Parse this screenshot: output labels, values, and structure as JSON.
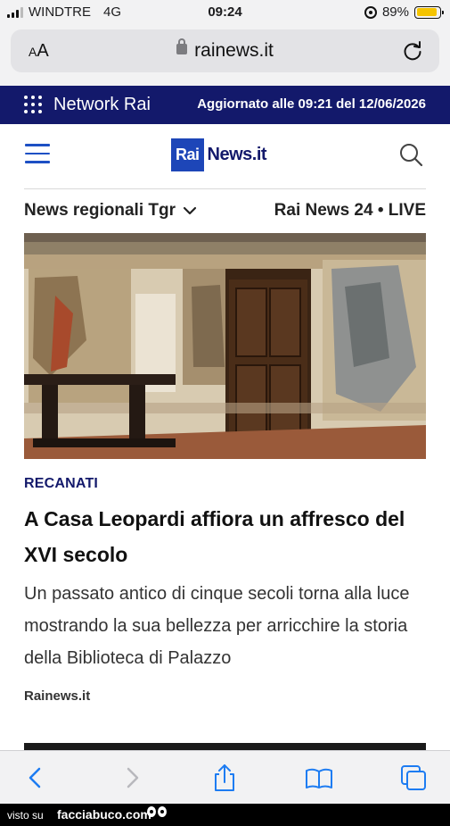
{
  "status_bar": {
    "carrier": "WINDTRE",
    "network": "4G",
    "time": "09:24",
    "battery": "89%",
    "battery_level": 0.89
  },
  "address_bar": {
    "aa_label": "AA",
    "domain": "rainews.it"
  },
  "network_bar": {
    "label": "Network Rai",
    "updated": "Aggiornato alle 09:21 del 12/06/2026"
  },
  "header": {
    "logo_rai": "Rai",
    "logo_news": "News.it",
    "regional_link": "News regionali Tgr",
    "live_link": "Rai News 24 • LIVE"
  },
  "article": {
    "kicker": "RECANATI",
    "title": "A Casa Leopardi affiora un affresco del XVI secolo",
    "summary": "Un passato antico di cinque secoli torna alla luce mostrando la sua bellezza per arricchire la storia della Biblioteca di Palazzo",
    "source": "Rainews.it"
  },
  "watermark": {
    "prefix": "visto su",
    "brand": "facciabuco.com"
  },
  "colors": {
    "brand_navy": "#13196b",
    "brand_blue": "#1d46b8",
    "ios_blue": "#1d7cf2"
  }
}
